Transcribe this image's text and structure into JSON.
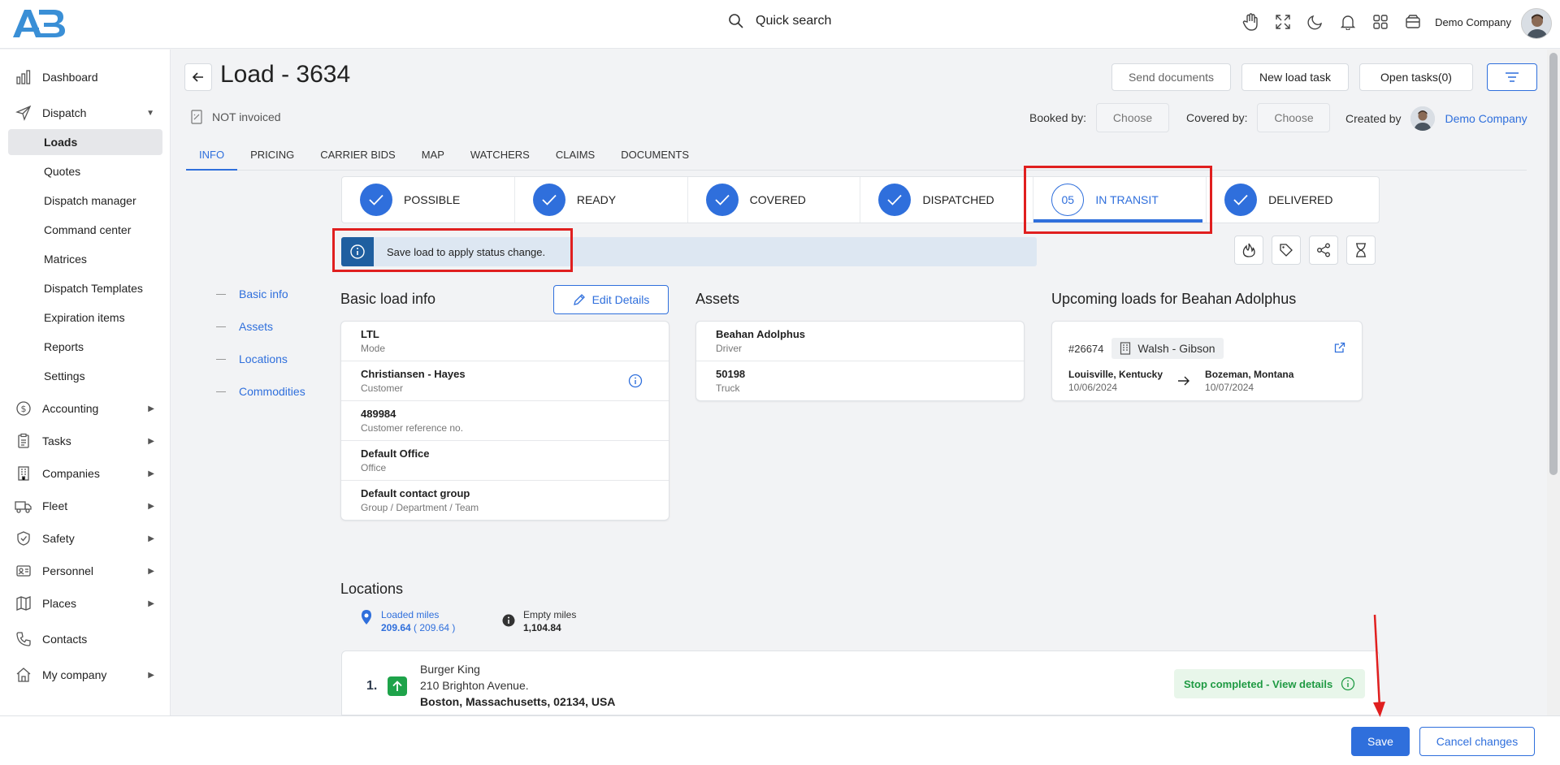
{
  "topbar": {
    "search_label": "Quick search",
    "company": "Demo Company",
    "icons": [
      "hand-icon",
      "fullscreen-icon",
      "moon-icon",
      "bell-icon",
      "apps-grid-icon",
      "wallet-icon"
    ]
  },
  "sidebar": {
    "dashboard": "Dashboard",
    "dispatch": "Dispatch",
    "dispatch_items": [
      "Loads",
      "Quotes",
      "Dispatch manager",
      "Command center",
      "Matrices",
      "Dispatch Templates",
      "Expiration items",
      "Reports",
      "Settings"
    ],
    "accounting": "Accounting",
    "tasks": "Tasks",
    "companies": "Companies",
    "fleet": "Fleet",
    "safety": "Safety",
    "personnel": "Personnel",
    "places": "Places",
    "contacts": "Contacts",
    "my_company": "My company"
  },
  "header": {
    "title": "Load - 3634",
    "send_documents": "Send documents",
    "new_load_task": "New load task",
    "open_tasks": "Open tasks(0)",
    "invoice_status": "NOT invoiced",
    "booked_by_label": "Booked by:",
    "booked_by_value": "Choose",
    "covered_by_label": "Covered by:",
    "covered_by_value": "Choose",
    "created_by_label": "Created by",
    "created_by_value": "Demo Company"
  },
  "tabs": [
    "INFO",
    "PRICING",
    "CARRIER BIDS",
    "MAP",
    "WATCHERS",
    "CLAIMS",
    "DOCUMENTS"
  ],
  "steps": {
    "s1": "POSSIBLE",
    "s2": "READY",
    "s3": "COVERED",
    "s4": "DISPATCHED",
    "s5_num": "05",
    "s5": "IN TRANSIT",
    "s6": "DELIVERED"
  },
  "alert": "Save load to apply status change.",
  "anchors": [
    "Basic info",
    "Assets",
    "Locations",
    "Commodities"
  ],
  "basic_info": {
    "title": "Basic load info",
    "edit_button": "Edit Details",
    "fields": [
      {
        "value": "LTL",
        "label": "Mode"
      },
      {
        "value": "Christiansen - Hayes",
        "label": "Customer"
      },
      {
        "value": "489984",
        "label": "Customer reference no."
      },
      {
        "value": "Default Office",
        "label": "Office"
      },
      {
        "value": "Default contact group",
        "label": "Group / Department / Team"
      }
    ]
  },
  "assets": {
    "title": "Assets",
    "fields": [
      {
        "value": "Beahan Adolphus",
        "label": "Driver"
      },
      {
        "value": "50198",
        "label": "Truck"
      }
    ]
  },
  "upcoming": {
    "title": "Upcoming loads for Beahan Adolphus",
    "load_no": "#26674",
    "company": "Walsh - Gibson",
    "from_city": "Louisville, Kentucky",
    "from_date": "10/06/2024",
    "to_city": "Bozeman, Montana",
    "to_date": "10/07/2024"
  },
  "locations": {
    "title": "Locations",
    "loaded_label": "Loaded miles",
    "loaded_value": "209.64",
    "loaded_paren": "( 209.64 )",
    "empty_label": "Empty miles",
    "empty_value": "1,104.84",
    "stop": {
      "num": "1.",
      "name": "Burger King",
      "street": "210 Brighton Avenue.",
      "city": "Boston, Massachusetts, 02134, USA",
      "badge": "Stop completed - View details"
    }
  },
  "footer": {
    "save": "Save",
    "cancel": "Cancel changes"
  },
  "colors": {
    "accent": "#2f6fdc",
    "annotation_red": "#e01f1f",
    "success_green": "#1f9a43"
  }
}
